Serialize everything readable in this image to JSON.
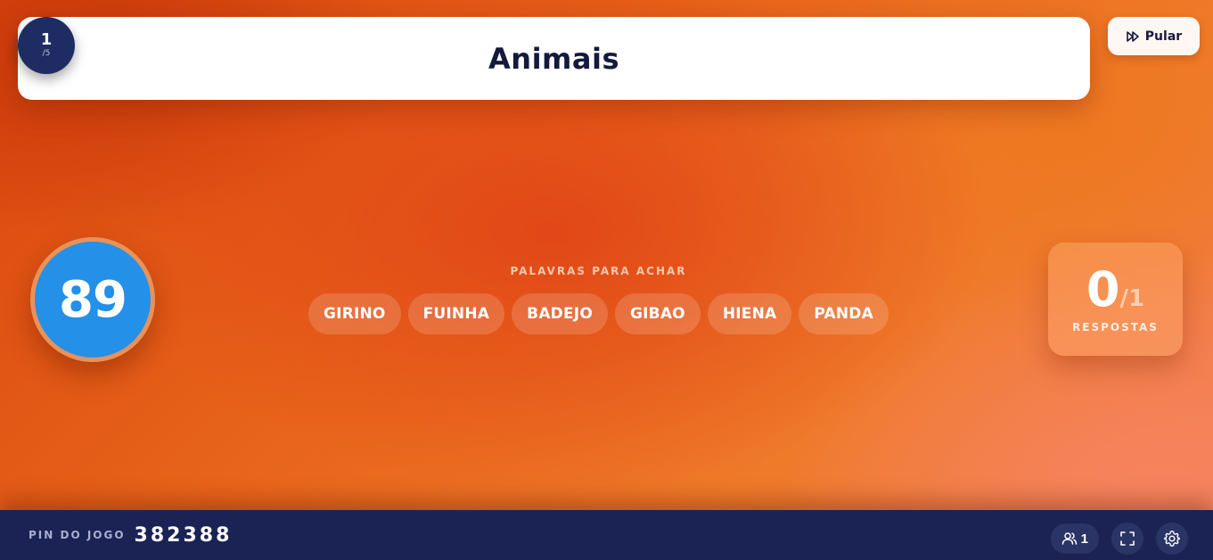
{
  "header": {
    "title": "Animais",
    "round_current": "1",
    "round_total": "/5",
    "skip_label": "Pular"
  },
  "timer": {
    "value": "89"
  },
  "words": {
    "label": "PALAVRAS PARA ACHAR",
    "items": [
      "GIRINO",
      "FUINHA",
      "BADEJO",
      "GIBAO",
      "HIENA",
      "PANDA"
    ]
  },
  "answers": {
    "value": "0",
    "total": "/1",
    "label": "RESPOSTAS"
  },
  "footer": {
    "pin_label": "PIN DO JOGO",
    "pin_value": "382388",
    "players_count": "1"
  },
  "icons": {
    "skip": "fast-forward-icon",
    "players": "users-icon",
    "fullscreen": "fullscreen-icon",
    "settings": "gear-icon"
  },
  "colors": {
    "header_text": "#141a3c",
    "round_badge": "#1f2b63",
    "timer": "#2490e8",
    "footer": "#1b2354"
  }
}
